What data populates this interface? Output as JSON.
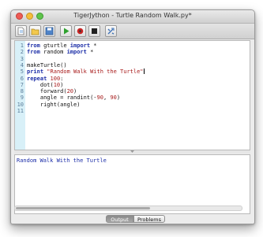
{
  "window": {
    "title": "TigerJython - Turtle Random Walk.py*"
  },
  "toolbar": {
    "buttons": [
      {
        "name": "new-file-icon"
      },
      {
        "name": "open-file-icon"
      },
      {
        "name": "save-icon"
      },
      {
        "name": "run-icon"
      },
      {
        "name": "debug-icon"
      },
      {
        "name": "stop-icon"
      },
      {
        "name": "settings-icon"
      }
    ]
  },
  "editor": {
    "lines": [
      {
        "n": "1",
        "parts": [
          [
            "kw",
            "from"
          ],
          [
            "t",
            " gturtle "
          ],
          [
            "kw",
            "import"
          ],
          [
            "t",
            " *"
          ]
        ]
      },
      {
        "n": "2",
        "parts": [
          [
            "kw",
            "from"
          ],
          [
            "t",
            " random "
          ],
          [
            "kw",
            "import"
          ],
          [
            "t",
            " *"
          ]
        ]
      },
      {
        "n": "3",
        "parts": []
      },
      {
        "n": "4",
        "parts": [
          [
            "t",
            "makeTurtle()"
          ]
        ]
      },
      {
        "n": "5",
        "parts": [
          [
            "kw",
            "print"
          ],
          [
            "t",
            " "
          ],
          [
            "str",
            "\"Random Walk With the Turtle\""
          ]
        ],
        "caret": true
      },
      {
        "n": "6",
        "parts": [
          [
            "kw",
            "repeat"
          ],
          [
            "t",
            " "
          ],
          [
            "num",
            "100"
          ],
          [
            "t",
            ":"
          ]
        ]
      },
      {
        "n": "7",
        "parts": [
          [
            "t",
            "    dot("
          ],
          [
            "num",
            "10"
          ],
          [
            "t",
            ")"
          ]
        ]
      },
      {
        "n": "8",
        "parts": [
          [
            "t",
            "    forward("
          ],
          [
            "num",
            "20"
          ],
          [
            "t",
            ")"
          ]
        ]
      },
      {
        "n": "9",
        "parts": [
          [
            "t",
            "    angle = randint(-"
          ],
          [
            "num",
            "90"
          ],
          [
            "t",
            ", "
          ],
          [
            "num",
            "90"
          ],
          [
            "t",
            ")"
          ]
        ]
      },
      {
        "n": "10",
        "parts": [
          [
            "t",
            "    right(angle)"
          ]
        ]
      },
      {
        "n": "11",
        "parts": []
      }
    ]
  },
  "console": {
    "output": "Random Walk With the Turtle"
  },
  "tabs": {
    "output": "Output",
    "problems": "Problems"
  },
  "colors": {
    "keyword": "#1d2fa8",
    "string": "#a81c1c",
    "gutter": "#d8f0f8"
  }
}
